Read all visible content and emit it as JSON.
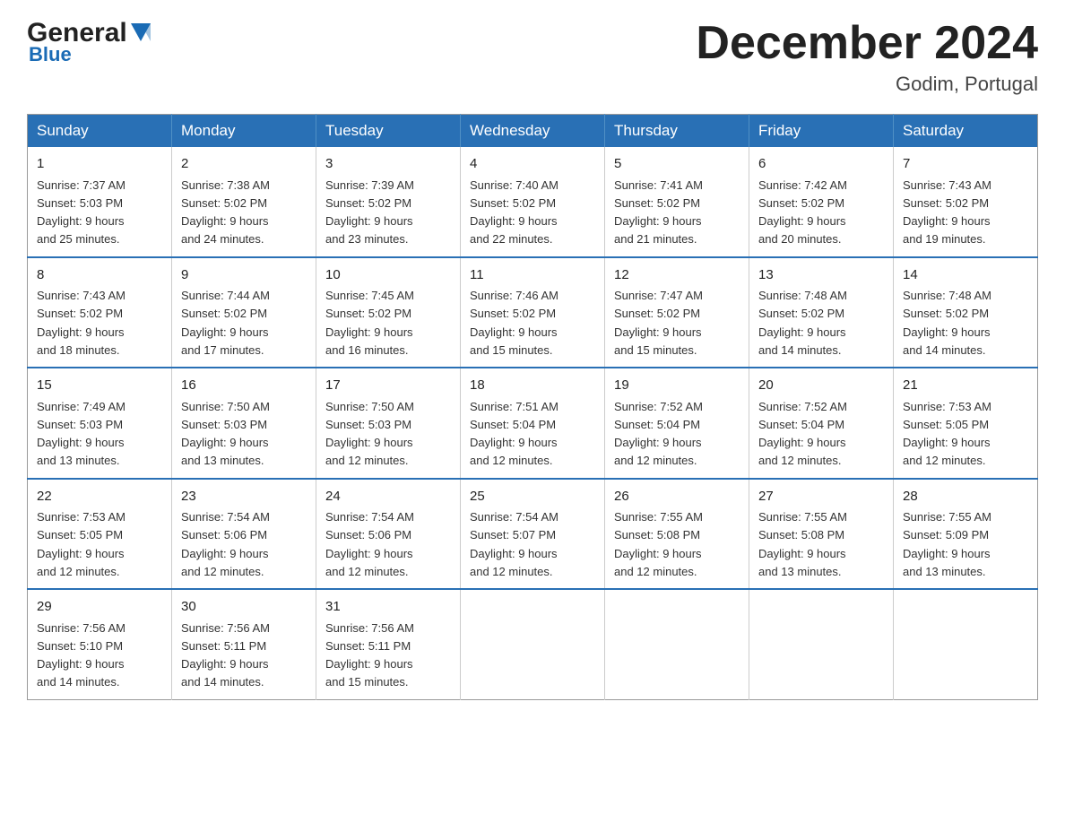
{
  "logo": {
    "general": "General",
    "blue": "Blue",
    "aria": "GeneralBlue logo"
  },
  "header": {
    "month": "December 2024",
    "location": "Godim, Portugal"
  },
  "weekdays": [
    "Sunday",
    "Monday",
    "Tuesday",
    "Wednesday",
    "Thursday",
    "Friday",
    "Saturday"
  ],
  "weeks": [
    [
      {
        "day": "1",
        "sunrise": "7:37 AM",
        "sunset": "5:03 PM",
        "daylight": "9 hours and 25 minutes."
      },
      {
        "day": "2",
        "sunrise": "7:38 AM",
        "sunset": "5:02 PM",
        "daylight": "9 hours and 24 minutes."
      },
      {
        "day": "3",
        "sunrise": "7:39 AM",
        "sunset": "5:02 PM",
        "daylight": "9 hours and 23 minutes."
      },
      {
        "day": "4",
        "sunrise": "7:40 AM",
        "sunset": "5:02 PM",
        "daylight": "9 hours and 22 minutes."
      },
      {
        "day": "5",
        "sunrise": "7:41 AM",
        "sunset": "5:02 PM",
        "daylight": "9 hours and 21 minutes."
      },
      {
        "day": "6",
        "sunrise": "7:42 AM",
        "sunset": "5:02 PM",
        "daylight": "9 hours and 20 minutes."
      },
      {
        "day": "7",
        "sunrise": "7:43 AM",
        "sunset": "5:02 PM",
        "daylight": "9 hours and 19 minutes."
      }
    ],
    [
      {
        "day": "8",
        "sunrise": "7:43 AM",
        "sunset": "5:02 PM",
        "daylight": "9 hours and 18 minutes."
      },
      {
        "day": "9",
        "sunrise": "7:44 AM",
        "sunset": "5:02 PM",
        "daylight": "9 hours and 17 minutes."
      },
      {
        "day": "10",
        "sunrise": "7:45 AM",
        "sunset": "5:02 PM",
        "daylight": "9 hours and 16 minutes."
      },
      {
        "day": "11",
        "sunrise": "7:46 AM",
        "sunset": "5:02 PM",
        "daylight": "9 hours and 15 minutes."
      },
      {
        "day": "12",
        "sunrise": "7:47 AM",
        "sunset": "5:02 PM",
        "daylight": "9 hours and 15 minutes."
      },
      {
        "day": "13",
        "sunrise": "7:48 AM",
        "sunset": "5:02 PM",
        "daylight": "9 hours and 14 minutes."
      },
      {
        "day": "14",
        "sunrise": "7:48 AM",
        "sunset": "5:02 PM",
        "daylight": "9 hours and 14 minutes."
      }
    ],
    [
      {
        "day": "15",
        "sunrise": "7:49 AM",
        "sunset": "5:03 PM",
        "daylight": "9 hours and 13 minutes."
      },
      {
        "day": "16",
        "sunrise": "7:50 AM",
        "sunset": "5:03 PM",
        "daylight": "9 hours and 13 minutes."
      },
      {
        "day": "17",
        "sunrise": "7:50 AM",
        "sunset": "5:03 PM",
        "daylight": "9 hours and 12 minutes."
      },
      {
        "day": "18",
        "sunrise": "7:51 AM",
        "sunset": "5:04 PM",
        "daylight": "9 hours and 12 minutes."
      },
      {
        "day": "19",
        "sunrise": "7:52 AM",
        "sunset": "5:04 PM",
        "daylight": "9 hours and 12 minutes."
      },
      {
        "day": "20",
        "sunrise": "7:52 AM",
        "sunset": "5:04 PM",
        "daylight": "9 hours and 12 minutes."
      },
      {
        "day": "21",
        "sunrise": "7:53 AM",
        "sunset": "5:05 PM",
        "daylight": "9 hours and 12 minutes."
      }
    ],
    [
      {
        "day": "22",
        "sunrise": "7:53 AM",
        "sunset": "5:05 PM",
        "daylight": "9 hours and 12 minutes."
      },
      {
        "day": "23",
        "sunrise": "7:54 AM",
        "sunset": "5:06 PM",
        "daylight": "9 hours and 12 minutes."
      },
      {
        "day": "24",
        "sunrise": "7:54 AM",
        "sunset": "5:06 PM",
        "daylight": "9 hours and 12 minutes."
      },
      {
        "day": "25",
        "sunrise": "7:54 AM",
        "sunset": "5:07 PM",
        "daylight": "9 hours and 12 minutes."
      },
      {
        "day": "26",
        "sunrise": "7:55 AM",
        "sunset": "5:08 PM",
        "daylight": "9 hours and 12 minutes."
      },
      {
        "day": "27",
        "sunrise": "7:55 AM",
        "sunset": "5:08 PM",
        "daylight": "9 hours and 13 minutes."
      },
      {
        "day": "28",
        "sunrise": "7:55 AM",
        "sunset": "5:09 PM",
        "daylight": "9 hours and 13 minutes."
      }
    ],
    [
      {
        "day": "29",
        "sunrise": "7:56 AM",
        "sunset": "5:10 PM",
        "daylight": "9 hours and 14 minutes."
      },
      {
        "day": "30",
        "sunrise": "7:56 AM",
        "sunset": "5:11 PM",
        "daylight": "9 hours and 14 minutes."
      },
      {
        "day": "31",
        "sunrise": "7:56 AM",
        "sunset": "5:11 PM",
        "daylight": "9 hours and 15 minutes."
      },
      null,
      null,
      null,
      null
    ]
  ],
  "labels": {
    "sunrise": "Sunrise:",
    "sunset": "Sunset:",
    "daylight": "Daylight:"
  }
}
